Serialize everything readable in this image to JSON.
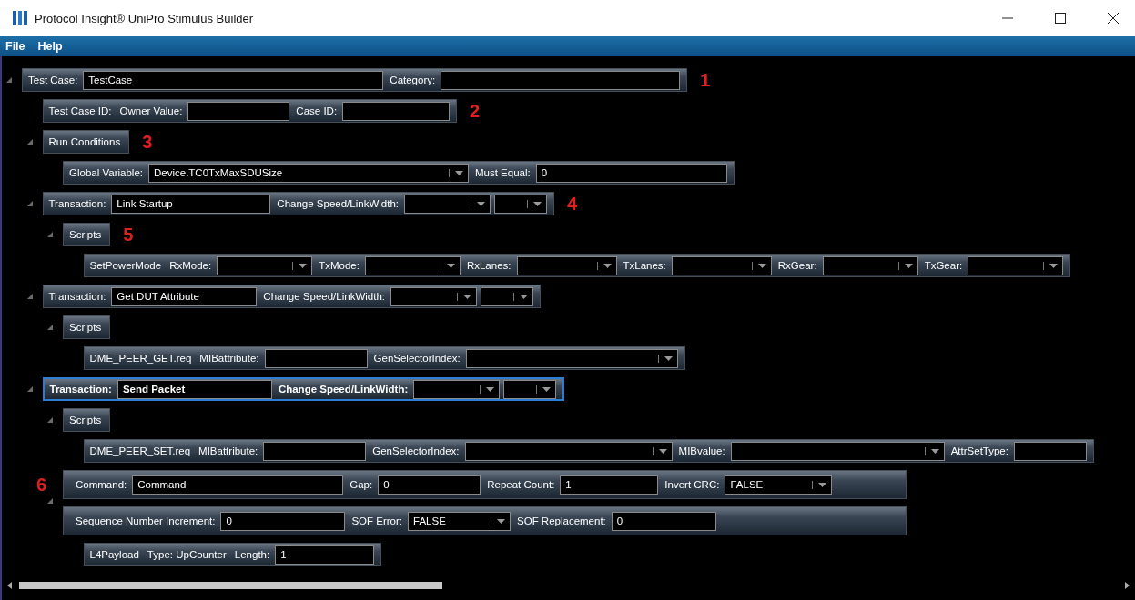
{
  "window": {
    "title": "Protocol Insight® UniPro Stimulus Builder"
  },
  "menu": [
    "File",
    "Help"
  ],
  "tree": [
    {
      "selected": false,
      "expanded": true,
      "callout": "1",
      "items": [
        {
          "kind": "field",
          "label": "Test Case:",
          "value": "TestCase"
        },
        {
          "kind": "field",
          "label": "Category:"
        }
      ],
      "children": [
        {
          "selected": false,
          "callout": "2",
          "items": [
            {
              "kind": "label",
              "text": "Test Case ID:"
            },
            {
              "kind": "field",
              "label": "Owner Value:"
            },
            {
              "kind": "field",
              "label": "Case ID:"
            }
          ]
        },
        {
          "selected": false,
          "expanded": true,
          "callout": "3",
          "items": [
            {
              "kind": "label",
              "text": "Run Conditions"
            }
          ],
          "children": [
            {
              "selected": false,
              "items": [
                {
                  "kind": "combo",
                  "label": "Global Variable:",
                  "value": "Device.TC0TxMaxSDUSize"
                },
                {
                  "kind": "field",
                  "label": "Must Equal:",
                  "value": "0"
                }
              ]
            }
          ]
        },
        {
          "selected": false,
          "expanded": true,
          "callout": "4",
          "items": [
            {
              "kind": "field",
              "label": "Transaction:",
              "value": "Link Startup"
            },
            {
              "kind": "combo",
              "label": "Change Speed/LinkWidth:"
            },
            {
              "kind": "combo"
            }
          ],
          "children": [
            {
              "selected": false,
              "expanded": true,
              "callout": "5",
              "items": [
                {
                  "kind": "label",
                  "text": "Scripts"
                }
              ],
              "children": [
                {
                  "selected": false,
                  "items": [
                    {
                      "kind": "label",
                      "text": "SetPowerMode"
                    },
                    {
                      "kind": "combo",
                      "label": "RxMode:"
                    },
                    {
                      "kind": "combo",
                      "label": "TxMode:"
                    },
                    {
                      "kind": "combo",
                      "label": "RxLanes:"
                    },
                    {
                      "kind": "combo",
                      "label": "TxLanes:"
                    },
                    {
                      "kind": "combo",
                      "label": "RxGear:"
                    },
                    {
                      "kind": "combo",
                      "label": "TxGear:"
                    }
                  ]
                }
              ]
            }
          ]
        },
        {
          "selected": false,
          "expanded": true,
          "items": [
            {
              "kind": "field",
              "label": "Transaction:",
              "value": "Get DUT Attribute"
            },
            {
              "kind": "combo",
              "label": "Change Speed/LinkWidth:"
            },
            {
              "kind": "combo"
            }
          ],
          "children": [
            {
              "selected": false,
              "expanded": true,
              "items": [
                {
                  "kind": "label",
                  "text": "Scripts"
                }
              ],
              "children": [
                {
                  "selected": false,
                  "items": [
                    {
                      "kind": "label",
                      "text": "DME_PEER_GET.req"
                    },
                    {
                      "kind": "field",
                      "label": "MIBattribute:"
                    },
                    {
                      "kind": "combo",
                      "label": "GenSelectorIndex:"
                    }
                  ]
                }
              ]
            }
          ]
        },
        {
          "selected": true,
          "expanded": true,
          "items": [
            {
              "kind": "field",
              "label": "Transaction:",
              "value": "Send Packet"
            },
            {
              "kind": "combo",
              "label": "Change Speed/LinkWidth:"
            },
            {
              "kind": "combo"
            }
          ],
          "children": [
            {
              "selected": false,
              "expanded": true,
              "items": [
                {
                  "kind": "label",
                  "text": "Scripts"
                }
              ],
              "children": [
                {
                  "selected": false,
                  "items": [
                    {
                      "kind": "label",
                      "text": "DME_PEER_SET.req"
                    },
                    {
                      "kind": "field",
                      "label": "MIBattribute:"
                    },
                    {
                      "kind": "combo",
                      "label": "GenSelectorIndex:"
                    },
                    {
                      "kind": "combo",
                      "label": "MIBvalue:"
                    },
                    {
                      "kind": "field",
                      "label": "AttrSetType:"
                    }
                  ]
                }
              ]
            },
            {
              "selected": false,
              "expanded": true,
              "leading_callout": "6",
              "items": [
                {
                  "kind": "field",
                  "label": "Command:",
                  "value": "Command"
                },
                {
                  "kind": "field",
                  "label": "Gap:",
                  "value": "0"
                },
                {
                  "kind": "field",
                  "label": "Repeat Count:",
                  "value": "1"
                },
                {
                  "kind": "combo",
                  "label": "Invert CRC:",
                  "value": "FALSE"
                }
              ]
            },
            {
              "selected": false,
              "items": [
                {
                  "kind": "field",
                  "label": "Sequence Number Increment:",
                  "value": "0"
                },
                {
                  "kind": "combo",
                  "label": "SOF Error:",
                  "value": "FALSE"
                },
                {
                  "kind": "field",
                  "label": "SOF Replacement:",
                  "value": "0"
                }
              ],
              "children": [
                {
                  "selected": false,
                  "items": [
                    {
                      "kind": "label",
                      "text": "L4Payload"
                    },
                    {
                      "kind": "label",
                      "text": "Type: UpCounter"
                    },
                    {
                      "kind": "field",
                      "label": "Length:",
                      "value": "1"
                    }
                  ]
                }
              ]
            }
          ]
        }
      ]
    }
  ]
}
